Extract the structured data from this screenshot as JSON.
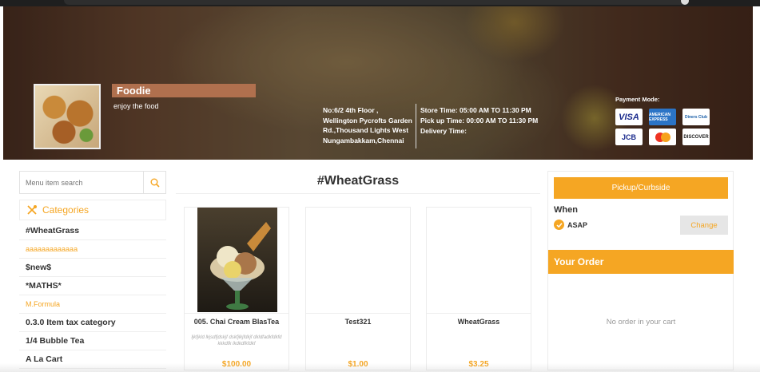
{
  "store": {
    "name": "Foodie",
    "tagline": "enjoy the food",
    "address_lines": [
      "No:6/2 4th Floor ,",
      "Wellington Pycrofts Garden",
      "Rd.,Thousand Lights West",
      "Nungambakkam,Chennai"
    ],
    "store_time": "Store Time: 05:00 AM TO 11:30 PM",
    "pickup_time": "Pick up Time: 00:00 AM TO 11:30 PM",
    "delivery_time": "Delivery Time:",
    "payment_title": "Payment Mode:",
    "payment_cards": [
      {
        "name": "visa-card",
        "label": "VISA"
      },
      {
        "name": "amex-card",
        "label": "AMERICAN EXPRESS"
      },
      {
        "name": "diners-card",
        "label": "Diners Club"
      },
      {
        "name": "jcb-card",
        "label": "JCB"
      },
      {
        "name": "mastercard-card",
        "label": "MasterCard"
      },
      {
        "name": "discover-card",
        "label": "DISCOVER"
      }
    ]
  },
  "sidebar": {
    "search_placeholder": "Menu item search",
    "categories_title": "Categories",
    "categories": [
      {
        "label": "#WheatGrass",
        "style": "bold"
      },
      {
        "label": "aaaaaaaaaaaaa",
        "style": "orange"
      },
      {
        "label": "$new$",
        "style": "bold"
      },
      {
        "label": "*MATHS*",
        "style": "bold"
      },
      {
        "label": "M.Formula",
        "style": "orange"
      },
      {
        "label": "0.3.0 Item tax category",
        "style": "bold"
      },
      {
        "label": "1/4 Bubble Tea",
        "style": "bold"
      },
      {
        "label": "A La Cart",
        "style": "bold"
      }
    ]
  },
  "main": {
    "section_title": "#WheatGrass",
    "products": [
      {
        "name": "005. Chai Cream BlasTea",
        "desc": "ljkfjkld lkjsdfjdskjf dskfjlkjfdkjf dkldfadkfdkfd kkkdfk lkdkdfkfdkf",
        "price": "$100.00",
        "has_image": true
      },
      {
        "name": "Test321",
        "desc": "",
        "price": "$1.00",
        "has_image": false
      },
      {
        "name": "WheatGrass",
        "desc": "",
        "price": "$3.25",
        "has_image": false
      }
    ]
  },
  "order": {
    "pickup_label": "Pickup/Curbside",
    "when_label": "When",
    "asap_label": "ASAP",
    "change_label": "Change",
    "your_order_title": "Your Order",
    "empty_text": "No order in your cart"
  },
  "colors": {
    "accent": "#f5a623",
    "store_name_bg": "#b0704e"
  }
}
